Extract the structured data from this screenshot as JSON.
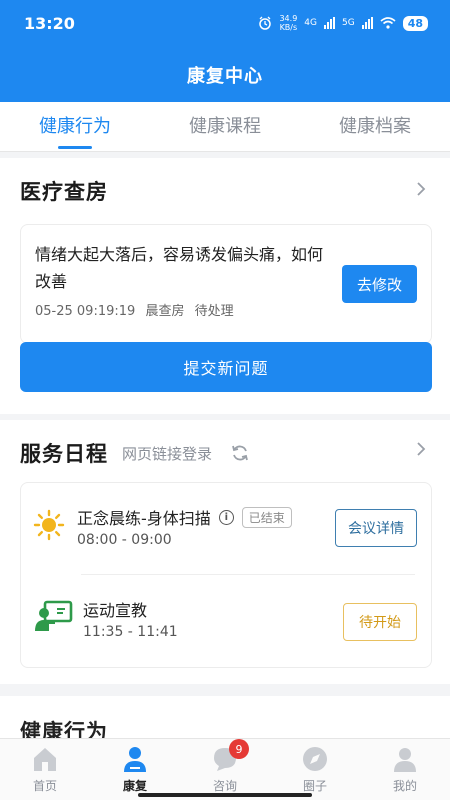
{
  "status_bar": {
    "time": "13:20",
    "speed_value": "34.9",
    "speed_unit": "KB/s",
    "network_4g": "4G",
    "network_5g": "5G",
    "battery": "48"
  },
  "header": {
    "title": "康复中心"
  },
  "tabs": [
    {
      "label": "健康行为",
      "active": true
    },
    {
      "label": "健康课程",
      "active": false
    },
    {
      "label": "健康档案",
      "active": false
    }
  ],
  "medical_rounds": {
    "title": "医疗查房",
    "question": "情绪大起大落后，容易诱发偏头痛，如何改善",
    "datetime": "05-25 09:19:19",
    "type": "晨查房",
    "status": "待处理",
    "edit_button": "去修改",
    "submit_button": "提交新问题"
  },
  "service_schedule": {
    "title": "服务日程",
    "subtitle": "网页链接登录",
    "items": [
      {
        "title": "正念晨练-身体扫描",
        "tag": "已结束",
        "time": "08:00 - 09:00",
        "button": "会议详情",
        "icon": "sun-icon"
      },
      {
        "title": "运动宣教",
        "time": "11:35 - 11:41",
        "button": "待开始",
        "icon": "screen-presenter-icon"
      }
    ]
  },
  "next_section": {
    "title": "健康行为"
  },
  "bottom_nav": [
    {
      "label": "首页",
      "icon": "home-icon"
    },
    {
      "label": "康复",
      "icon": "person-icon",
      "active": true
    },
    {
      "label": "咨询",
      "icon": "chat-icon",
      "badge": "9"
    },
    {
      "label": "圈子",
      "icon": "compass-icon"
    },
    {
      "label": "我的",
      "icon": "profile-icon"
    }
  ],
  "colors": {
    "primary": "#1e88f0",
    "pending": "#d39a17",
    "badge": "#e53935"
  }
}
